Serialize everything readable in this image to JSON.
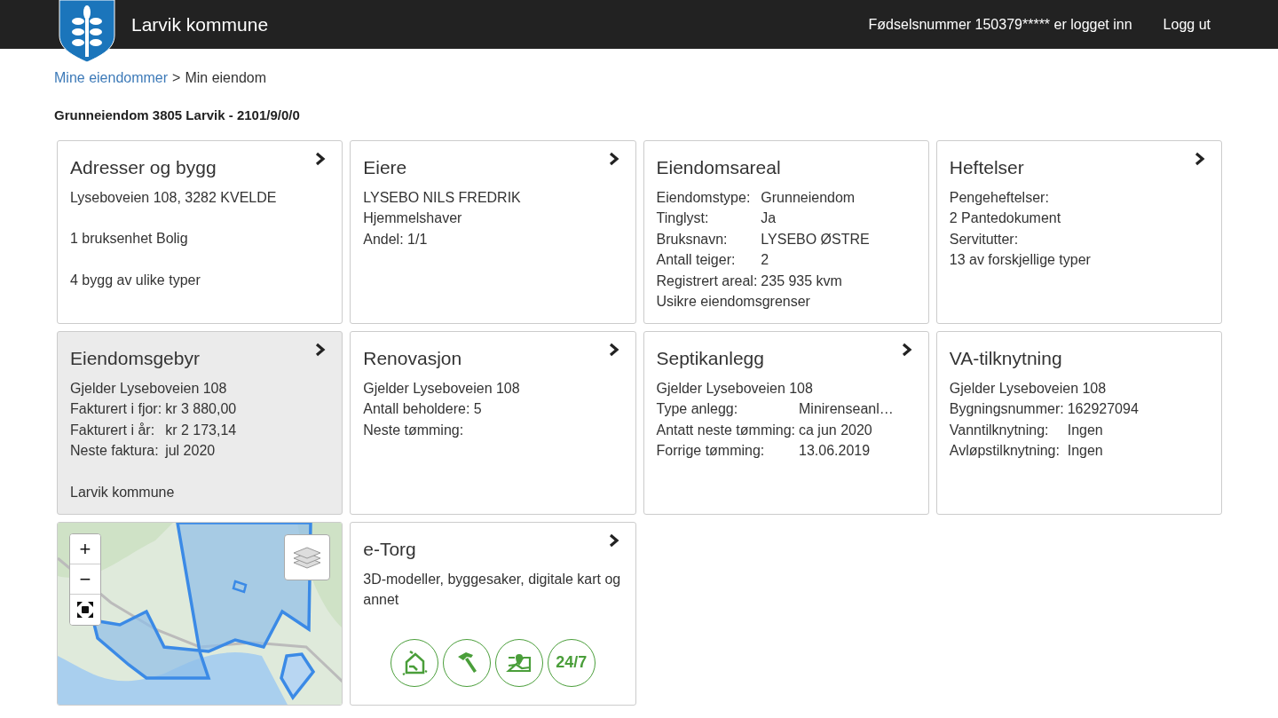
{
  "header": {
    "title": "Larvik kommune",
    "user_status": "Fødselsnummer 150379***** er logget inn",
    "logout": "Logg ut"
  },
  "breadcrumb": {
    "link": "Mine eiendommer",
    "separator": ">",
    "current": "Min eiendom"
  },
  "property_title": "Grunneiendom 3805 Larvik - 2101/9/0/0",
  "cards": [
    {
      "title": "Adresser og bygg",
      "has_link": true,
      "selected": false,
      "paragraphs": [
        [
          {
            "text": "Lyseboveien 108, 3282 KVELDE"
          }
        ],
        [
          {
            "text": "1 bruksenhet Bolig"
          }
        ],
        [
          {
            "text": "4 bygg av ulike typer"
          }
        ]
      ]
    },
    {
      "title": "Eiere",
      "has_link": true,
      "selected": false,
      "paragraphs": [
        [
          {
            "text": "LYSEBO NILS FREDRIK"
          },
          {
            "text": "Hjemmelshaver"
          },
          {
            "text": "Andel: 1/1"
          }
        ]
      ]
    },
    {
      "title": "Eiendomsareal",
      "has_link": false,
      "selected": false,
      "paragraphs": [
        [
          {
            "label": "Eiendomstype:",
            "value": "Grunneiendom"
          },
          {
            "label": "Tinglyst:",
            "value": "Ja"
          },
          {
            "label": "Bruksnavn:",
            "value": "LYSEBO ØSTRE"
          },
          {
            "label": "Antall teiger:",
            "value": "2"
          },
          {
            "label": "Registrert areal:",
            "value": "235 935 kvm"
          },
          {
            "text": "Usikre eiendomsgrenser"
          }
        ]
      ]
    },
    {
      "title": "Heftelser",
      "has_link": true,
      "selected": false,
      "paragraphs": [
        [
          {
            "text": "Pengeheftelser:"
          },
          {
            "text": "2 Pantedokument"
          },
          {
            "text": "Servitutter:"
          },
          {
            "text": "13 av forskjellige typer"
          }
        ]
      ]
    },
    {
      "title": "Eiendomsgebyr",
      "has_link": true,
      "selected": true,
      "paragraphs": [
        [
          {
            "text": "Gjelder Lyseboveien 108"
          },
          {
            "label": "Fakturert i fjor:",
            "value": "kr 3 880,00"
          },
          {
            "label": "Fakturert i år:",
            "value": "kr 2 173,14"
          },
          {
            "label": "Neste faktura:",
            "value": "jul 2020"
          }
        ],
        [
          {
            "text": "Larvik kommune"
          }
        ]
      ]
    },
    {
      "title": "Renovasjon",
      "has_link": true,
      "selected": false,
      "paragraphs": [
        [
          {
            "text": "Gjelder Lyseboveien 108"
          },
          {
            "text": "Antall beholdere: 5"
          },
          {
            "text": "Neste tømming:"
          }
        ]
      ]
    },
    {
      "title": "Septikanlegg",
      "has_link": true,
      "selected": false,
      "paragraphs": [
        [
          {
            "text": "Gjelder Lyseboveien 108"
          },
          {
            "label": "Type anlegg:",
            "value": "Minirenseanl…"
          },
          {
            "label": "Antatt neste tømming:",
            "value": "ca jun 2020"
          },
          {
            "label": "Forrige tømming:",
            "value": "13.06.2019"
          }
        ]
      ]
    },
    {
      "title": "VA-tilknytning",
      "has_link": false,
      "selected": false,
      "paragraphs": [
        [
          {
            "text": "Gjelder Lyseboveien 108"
          },
          {
            "label": "Bygningsnummer:",
            "value": "162927094"
          },
          {
            "label": "Vanntilknytning:",
            "value": "Ingen"
          },
          {
            "label": "Avløpstilknytning:",
            "value": "Ingen"
          }
        ]
      ]
    }
  ],
  "map": {
    "zoom_in": "+",
    "zoom_out": "−"
  },
  "etorg": {
    "title": "e-Torg",
    "has_link": true,
    "description": "3D-modeller, byggesaker, digitale kart og annet",
    "services": [
      {
        "kind": "house"
      },
      {
        "kind": "hammer"
      },
      {
        "kind": "map"
      },
      {
        "kind": "text",
        "label": "24/7"
      }
    ]
  }
}
